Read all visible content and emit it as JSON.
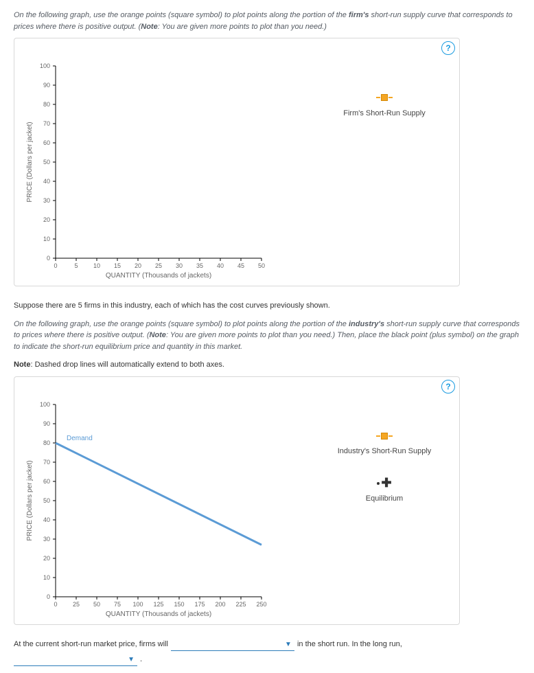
{
  "instructions": {
    "p1a": "On the following graph, use the orange points (square symbol) to plot points along the portion of the ",
    "p1b": "firm's",
    "p1c": " short-run supply curve that corresponds to prices where there is positive output. (",
    "p1d": "Note",
    "p1e": ": You are given more points to plot than you need.)",
    "mid": "Suppose there are 5 firms in this industry, each of which has the cost curves previously shown.",
    "p2a": "On the following graph, use the orange points (square symbol) to plot points along the portion of the ",
    "p2b": "industry's",
    "p2c": " short-run supply curve that corresponds to prices where there is positive output. (",
    "p2d": "Note",
    "p2e": ": You are given more points to plot than you need.) Then, place the black point (plus symbol) on the graph to indicate the short-run equilibrium price and quantity in this market.",
    "note": "Note",
    "note_body": ": Dashed drop lines will automatically extend to both axes."
  },
  "help_label": "?",
  "graph1": {
    "ylabel": "PRICE (Dollars per jacket)",
    "xlabel": "QUANTITY (Thousands of jackets)",
    "xticks": [
      "0",
      "5",
      "10",
      "15",
      "20",
      "25",
      "30",
      "35",
      "40",
      "45",
      "50"
    ],
    "yticks": [
      "0",
      "10",
      "20",
      "30",
      "40",
      "50",
      "60",
      "70",
      "80",
      "90",
      "100"
    ],
    "legend": {
      "supply": "Firm's Short-Run Supply"
    }
  },
  "graph2": {
    "ylabel": "PRICE (Dollars per jacket)",
    "xlabel": "QUANTITY (Thousands of jackets)",
    "xticks": [
      "0",
      "25",
      "50",
      "75",
      "100",
      "125",
      "150",
      "175",
      "200",
      "225",
      "250"
    ],
    "yticks": [
      "0",
      "10",
      "20",
      "30",
      "40",
      "50",
      "60",
      "70",
      "80",
      "90",
      "100"
    ],
    "demand_label": "Demand",
    "legend": {
      "supply": "Industry's Short-Run Supply",
      "eq": "Equilibrium"
    }
  },
  "fill": {
    "pre": "At the current short-run market price, firms will",
    "mid": "in the short run. In the long run,",
    "post": "."
  },
  "chart_data": [
    {
      "type": "scatter",
      "title": "Firm's Short-Run Supply (empty — user to plot)",
      "xlabel": "QUANTITY (Thousands of jackets)",
      "ylabel": "PRICE (Dollars per jacket)",
      "xlim": [
        0,
        50
      ],
      "ylim": [
        0,
        100
      ],
      "series": [
        {
          "name": "Firm's Short-Run Supply",
          "x": [],
          "y": []
        }
      ]
    },
    {
      "type": "line",
      "title": "Industry Market with Demand curve",
      "xlabel": "QUANTITY (Thousands of jackets)",
      "ylabel": "PRICE (Dollars per jacket)",
      "xlim": [
        0,
        250
      ],
      "ylim": [
        0,
        100
      ],
      "series": [
        {
          "name": "Demand",
          "x": [
            0,
            250
          ],
          "y": [
            80,
            27
          ]
        },
        {
          "name": "Industry's Short-Run Supply",
          "x": [],
          "y": []
        },
        {
          "name": "Equilibrium",
          "x": [],
          "y": []
        }
      ]
    }
  ]
}
